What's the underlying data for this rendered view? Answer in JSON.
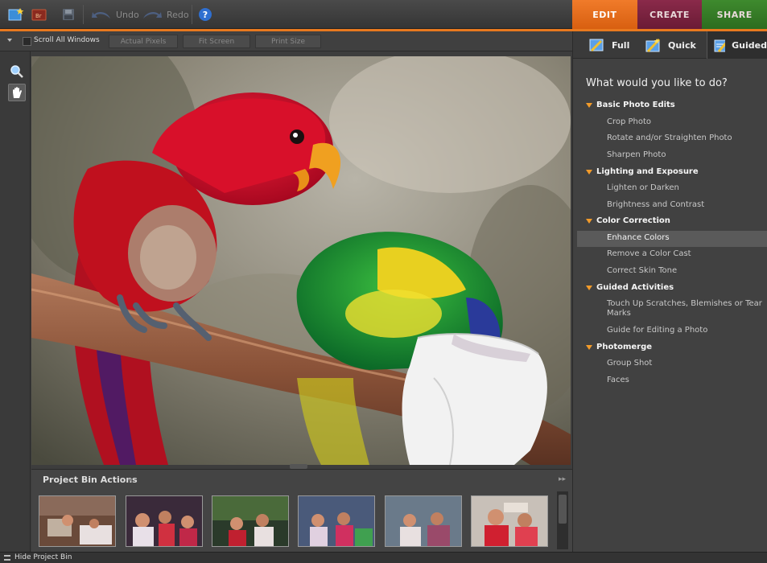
{
  "toolbar": {
    "undo_label": "Undo",
    "redo_label": "Redo",
    "help_icon_glyph": "?"
  },
  "mode_tabs": [
    {
      "label": "EDIT",
      "color": "#e8791f"
    },
    {
      "label": "CREATE",
      "color": "#7a2440"
    },
    {
      "label": "SHARE",
      "color": "#367d28"
    }
  ],
  "view_bar": {
    "scroll_all_label": "Scroll All Windows",
    "scroll_all_checked": false,
    "actual_pixels_label": "Actual Pixels",
    "fit_screen_label": "Fit Screen",
    "print_size_label": "Print Size"
  },
  "tools": [
    {
      "name": "zoom-tool",
      "icon": "magnifier-icon"
    },
    {
      "name": "hand-tool",
      "icon": "hand-icon",
      "active": true
    }
  ],
  "edit_subtabs": [
    {
      "label": "Full"
    },
    {
      "label": "Quick"
    },
    {
      "label": "Guided",
      "active": true
    }
  ],
  "guided": {
    "question": "What would you like to do?",
    "categories": [
      {
        "label": "Basic Photo Edits",
        "items": [
          "Crop Photo",
          "Rotate and/or Straighten Photo",
          "Sharpen Photo"
        ]
      },
      {
        "label": "Lighting and Exposure",
        "items": [
          "Lighten or Darken",
          "Brightness and Contrast"
        ]
      },
      {
        "label": "Color Correction",
        "items": [
          "Enhance Colors",
          "Remove a Color Cast",
          "Correct Skin Tone"
        ]
      },
      {
        "label": "Guided Activities",
        "items": [
          "Touch Up Scratches, Blemishes or Tear Marks",
          "Guide for Editing a Photo"
        ]
      },
      {
        "label": "Photomerge",
        "items": [
          "Group Shot",
          "Faces"
        ]
      }
    ],
    "highlighted_item": "Enhance Colors"
  },
  "project_bin": {
    "title": "Project Bin Actions",
    "more_glyph": "▸▸",
    "thumbnail_count": 6
  },
  "status": {
    "hide_bin_label": "Hide Project Bin"
  },
  "colors": {
    "accent_orange": "#e8791f",
    "panel_bg": "#414141",
    "category_arrow": "#f29b2a"
  }
}
